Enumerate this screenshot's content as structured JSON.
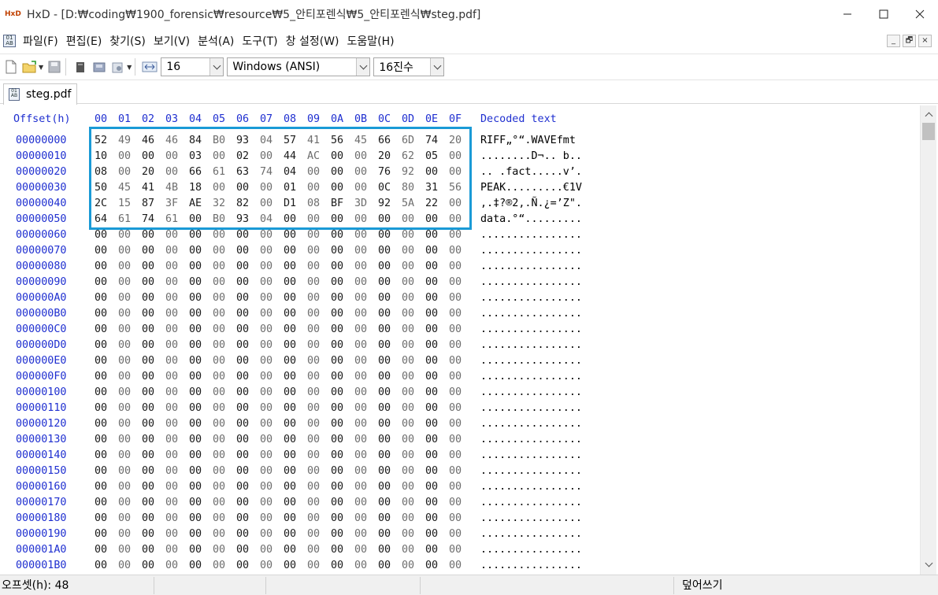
{
  "window": {
    "app_logo_text": "HxD",
    "title": "HxD - [D:₩coding₩1900_forensic₩resource₩5_안티포렌식₩5_안티포렌식₩steg.pdf]",
    "minimize_icon": "minimize-icon",
    "maximize_icon": "maximize-icon",
    "close_icon": "close-icon"
  },
  "menu": {
    "items": [
      "파일(F)",
      "편집(E)",
      "찾기(S)",
      "보기(V)",
      "분석(A)",
      "도구(T)",
      "창 설정(W)",
      "도움말(H)"
    ],
    "mdi_buttons": [
      "_",
      "🗗",
      "×"
    ]
  },
  "toolbar": {
    "bytes_per_row": "16",
    "charset": "Windows (ANSI)",
    "number_base": "16진수"
  },
  "tab": {
    "label": "steg.pdf"
  },
  "hex": {
    "offset_header": "Offset(h)",
    "column_headers": [
      "00",
      "01",
      "02",
      "03",
      "04",
      "05",
      "06",
      "07",
      "08",
      "09",
      "0A",
      "0B",
      "0C",
      "0D",
      "0E",
      "0F"
    ],
    "decoded_header": "Decoded text",
    "rows": [
      {
        "offset": "00000000",
        "bytes": [
          "52",
          "49",
          "46",
          "46",
          "84",
          "B0",
          "93",
          "04",
          "57",
          "41",
          "56",
          "45",
          "66",
          "6D",
          "74",
          "20"
        ],
        "text": "RIFF„°“.WAVEfmt"
      },
      {
        "offset": "00000010",
        "bytes": [
          "10",
          "00",
          "00",
          "00",
          "03",
          "00",
          "02",
          "00",
          "44",
          "AC",
          "00",
          "00",
          "20",
          "62",
          "05",
          "00"
        ],
        "text": "........D¬.. b.."
      },
      {
        "offset": "00000020",
        "bytes": [
          "08",
          "00",
          "20",
          "00",
          "66",
          "61",
          "63",
          "74",
          "04",
          "00",
          "00",
          "00",
          "76",
          "92",
          "00",
          "00"
        ],
        "text": ".. .fact.....v’."
      },
      {
        "offset": "00000030",
        "bytes": [
          "50",
          "45",
          "41",
          "4B",
          "18",
          "00",
          "00",
          "00",
          "01",
          "00",
          "00",
          "00",
          "0C",
          "80",
          "31",
          "56"
        ],
        "text": "PEAK.........€1V"
      },
      {
        "offset": "00000040",
        "bytes": [
          "2C",
          "15",
          "87",
          "3F",
          "AE",
          "32",
          "82",
          "00",
          "D1",
          "08",
          "BF",
          "3D",
          "92",
          "5A",
          "22",
          "00"
        ],
        "text": ",.‡?®2‚.Ñ.¿=’Z\"."
      },
      {
        "offset": "00000050",
        "bytes": [
          "64",
          "61",
          "74",
          "61",
          "00",
          "B0",
          "93",
          "04",
          "00",
          "00",
          "00",
          "00",
          "00",
          "00",
          "00",
          "00"
        ],
        "text": "data.°“........."
      },
      {
        "offset": "00000060",
        "bytes": [
          "00",
          "00",
          "00",
          "00",
          "00",
          "00",
          "00",
          "00",
          "00",
          "00",
          "00",
          "00",
          "00",
          "00",
          "00",
          "00"
        ],
        "text": "................"
      },
      {
        "offset": "00000070",
        "bytes": [
          "00",
          "00",
          "00",
          "00",
          "00",
          "00",
          "00",
          "00",
          "00",
          "00",
          "00",
          "00",
          "00",
          "00",
          "00",
          "00"
        ],
        "text": "................"
      },
      {
        "offset": "00000080",
        "bytes": [
          "00",
          "00",
          "00",
          "00",
          "00",
          "00",
          "00",
          "00",
          "00",
          "00",
          "00",
          "00",
          "00",
          "00",
          "00",
          "00"
        ],
        "text": "................"
      },
      {
        "offset": "00000090",
        "bytes": [
          "00",
          "00",
          "00",
          "00",
          "00",
          "00",
          "00",
          "00",
          "00",
          "00",
          "00",
          "00",
          "00",
          "00",
          "00",
          "00"
        ],
        "text": "................"
      },
      {
        "offset": "000000A0",
        "bytes": [
          "00",
          "00",
          "00",
          "00",
          "00",
          "00",
          "00",
          "00",
          "00",
          "00",
          "00",
          "00",
          "00",
          "00",
          "00",
          "00"
        ],
        "text": "................"
      },
      {
        "offset": "000000B0",
        "bytes": [
          "00",
          "00",
          "00",
          "00",
          "00",
          "00",
          "00",
          "00",
          "00",
          "00",
          "00",
          "00",
          "00",
          "00",
          "00",
          "00"
        ],
        "text": "................"
      },
      {
        "offset": "000000C0",
        "bytes": [
          "00",
          "00",
          "00",
          "00",
          "00",
          "00",
          "00",
          "00",
          "00",
          "00",
          "00",
          "00",
          "00",
          "00",
          "00",
          "00"
        ],
        "text": "................"
      },
      {
        "offset": "000000D0",
        "bytes": [
          "00",
          "00",
          "00",
          "00",
          "00",
          "00",
          "00",
          "00",
          "00",
          "00",
          "00",
          "00",
          "00",
          "00",
          "00",
          "00"
        ],
        "text": "................"
      },
      {
        "offset": "000000E0",
        "bytes": [
          "00",
          "00",
          "00",
          "00",
          "00",
          "00",
          "00",
          "00",
          "00",
          "00",
          "00",
          "00",
          "00",
          "00",
          "00",
          "00"
        ],
        "text": "................"
      },
      {
        "offset": "000000F0",
        "bytes": [
          "00",
          "00",
          "00",
          "00",
          "00",
          "00",
          "00",
          "00",
          "00",
          "00",
          "00",
          "00",
          "00",
          "00",
          "00",
          "00"
        ],
        "text": "................"
      },
      {
        "offset": "00000100",
        "bytes": [
          "00",
          "00",
          "00",
          "00",
          "00",
          "00",
          "00",
          "00",
          "00",
          "00",
          "00",
          "00",
          "00",
          "00",
          "00",
          "00"
        ],
        "text": "................"
      },
      {
        "offset": "00000110",
        "bytes": [
          "00",
          "00",
          "00",
          "00",
          "00",
          "00",
          "00",
          "00",
          "00",
          "00",
          "00",
          "00",
          "00",
          "00",
          "00",
          "00"
        ],
        "text": "................"
      },
      {
        "offset": "00000120",
        "bytes": [
          "00",
          "00",
          "00",
          "00",
          "00",
          "00",
          "00",
          "00",
          "00",
          "00",
          "00",
          "00",
          "00",
          "00",
          "00",
          "00"
        ],
        "text": "................"
      },
      {
        "offset": "00000130",
        "bytes": [
          "00",
          "00",
          "00",
          "00",
          "00",
          "00",
          "00",
          "00",
          "00",
          "00",
          "00",
          "00",
          "00",
          "00",
          "00",
          "00"
        ],
        "text": "................"
      },
      {
        "offset": "00000140",
        "bytes": [
          "00",
          "00",
          "00",
          "00",
          "00",
          "00",
          "00",
          "00",
          "00",
          "00",
          "00",
          "00",
          "00",
          "00",
          "00",
          "00"
        ],
        "text": "................"
      },
      {
        "offset": "00000150",
        "bytes": [
          "00",
          "00",
          "00",
          "00",
          "00",
          "00",
          "00",
          "00",
          "00",
          "00",
          "00",
          "00",
          "00",
          "00",
          "00",
          "00"
        ],
        "text": "................"
      },
      {
        "offset": "00000160",
        "bytes": [
          "00",
          "00",
          "00",
          "00",
          "00",
          "00",
          "00",
          "00",
          "00",
          "00",
          "00",
          "00",
          "00",
          "00",
          "00",
          "00"
        ],
        "text": "................"
      },
      {
        "offset": "00000170",
        "bytes": [
          "00",
          "00",
          "00",
          "00",
          "00",
          "00",
          "00",
          "00",
          "00",
          "00",
          "00",
          "00",
          "00",
          "00",
          "00",
          "00"
        ],
        "text": "................"
      },
      {
        "offset": "00000180",
        "bytes": [
          "00",
          "00",
          "00",
          "00",
          "00",
          "00",
          "00",
          "00",
          "00",
          "00",
          "00",
          "00",
          "00",
          "00",
          "00",
          "00"
        ],
        "text": "................"
      },
      {
        "offset": "00000190",
        "bytes": [
          "00",
          "00",
          "00",
          "00",
          "00",
          "00",
          "00",
          "00",
          "00",
          "00",
          "00",
          "00",
          "00",
          "00",
          "00",
          "00"
        ],
        "text": "................"
      },
      {
        "offset": "000001A0",
        "bytes": [
          "00",
          "00",
          "00",
          "00",
          "00",
          "00",
          "00",
          "00",
          "00",
          "00",
          "00",
          "00",
          "00",
          "00",
          "00",
          "00"
        ],
        "text": "................"
      },
      {
        "offset": "000001B0",
        "bytes": [
          "00",
          "00",
          "00",
          "00",
          "00",
          "00",
          "00",
          "00",
          "00",
          "00",
          "00",
          "00",
          "00",
          "00",
          "00",
          "00"
        ],
        "text": "................"
      }
    ]
  },
  "status": {
    "offset_text": "오프셋(h): 48",
    "mode_text": "덮어쓰기"
  },
  "colors": {
    "offset_blue": "#1f2fd0",
    "highlight_border": "#1a9ad6",
    "byte_dim": "#6d6d6d"
  }
}
